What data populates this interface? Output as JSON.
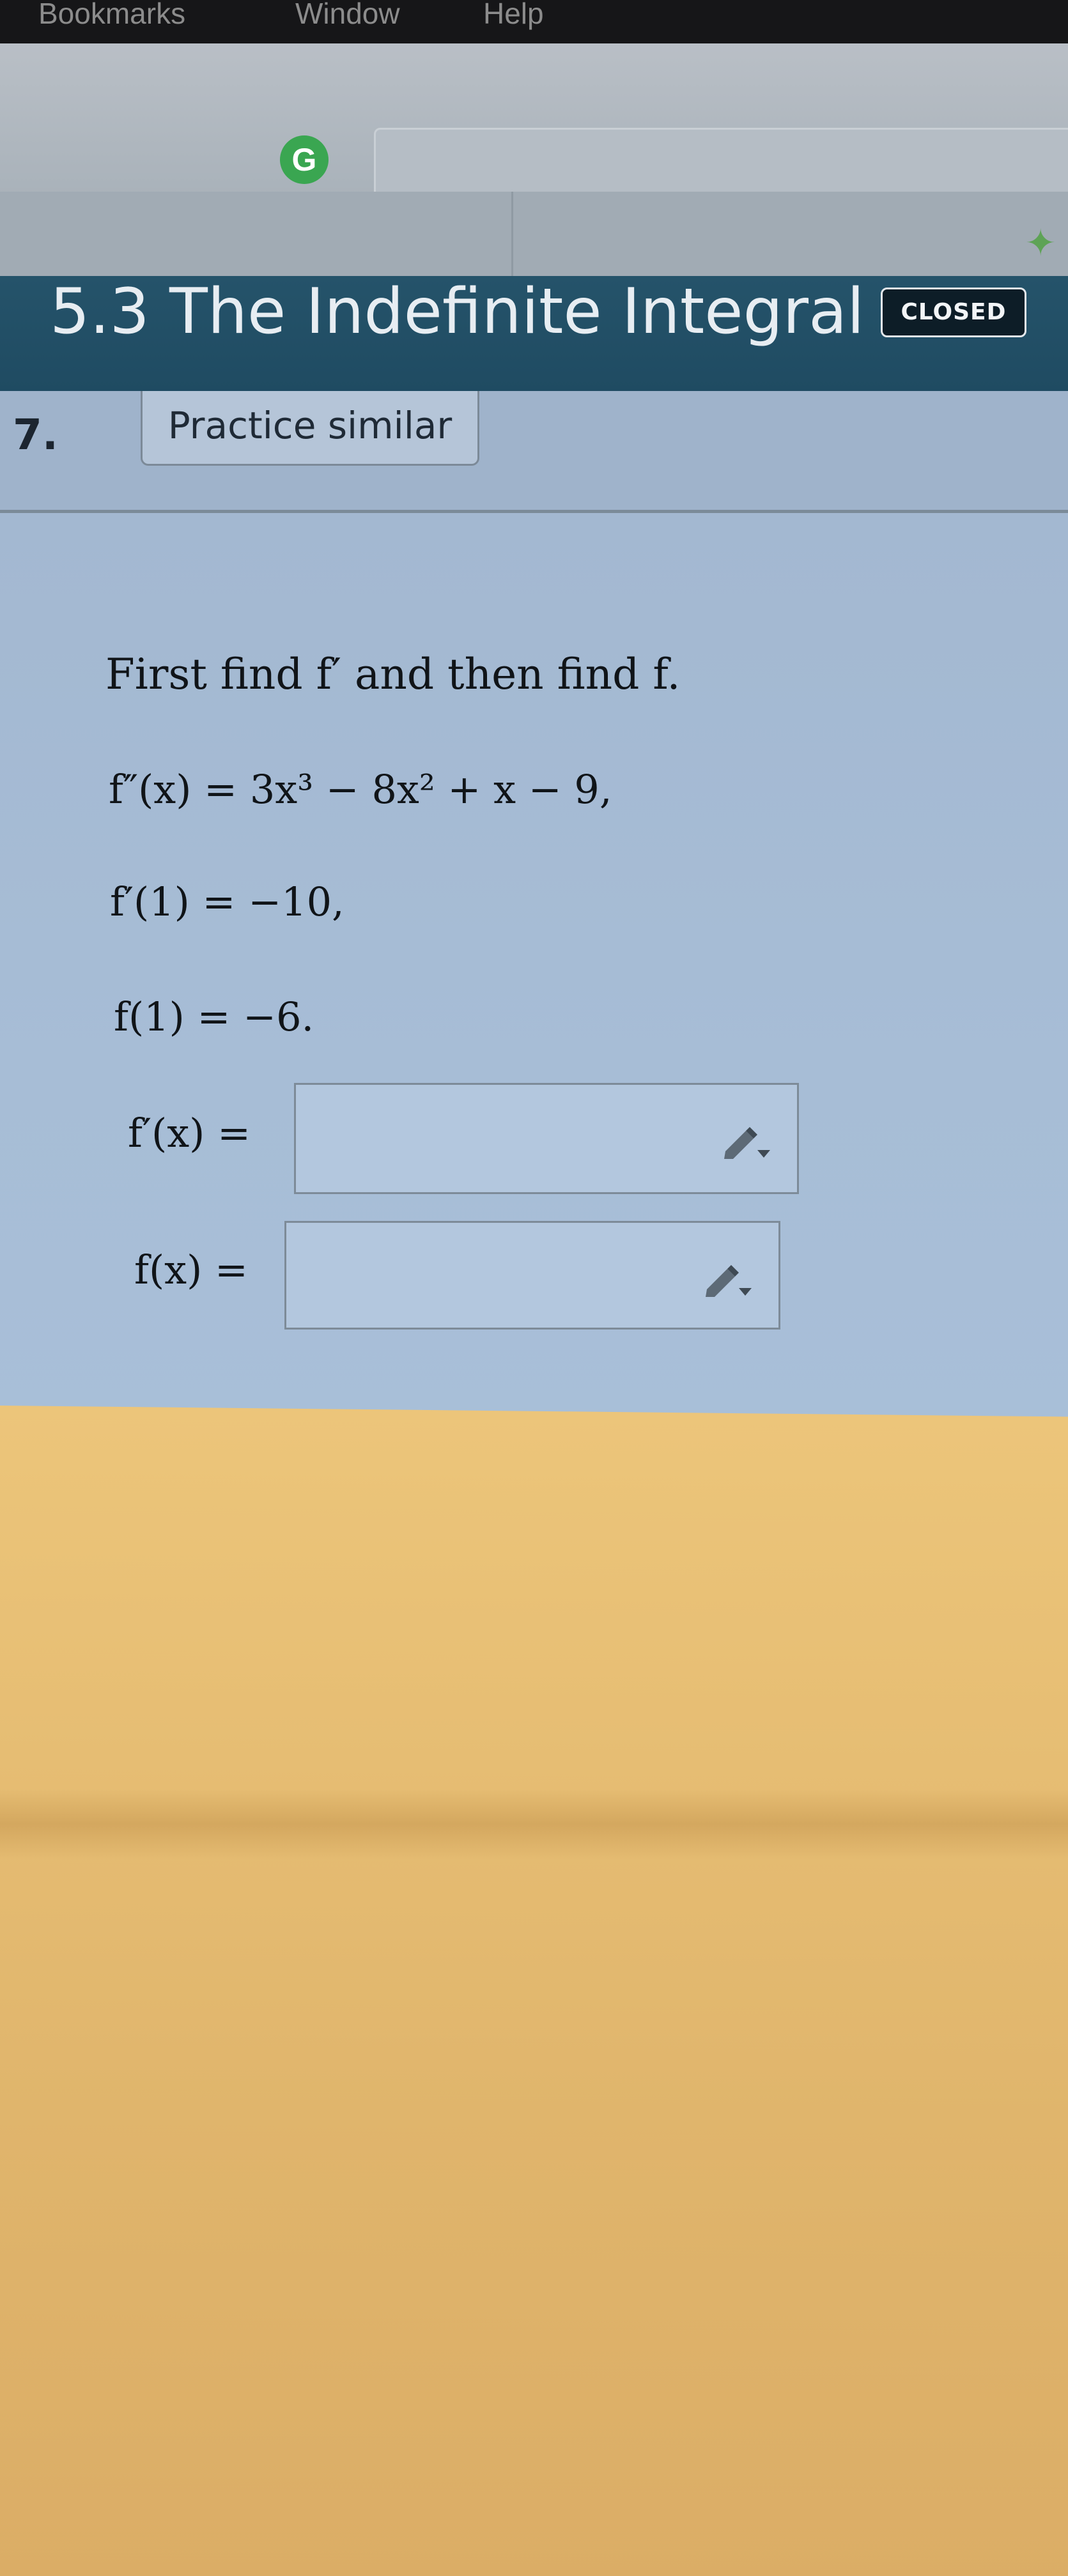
{
  "menubar": {
    "items": [
      "Bookmarks",
      "Window",
      "Help"
    ]
  },
  "toolbar": {
    "extension_letter": "G"
  },
  "section": {
    "title": "5.3 The Indefinite Integral",
    "badge": "CLOSED"
  },
  "question": {
    "number": "7.",
    "practice_label": "Practice similar"
  },
  "problem": {
    "instruction": "First find f′ and then find f.",
    "given": [
      "f″(x) = 3x³ − 8x² + x − 9,",
      "f′(1) = −10,",
      "f(1) = −6."
    ],
    "answers": [
      {
        "label": "f′(x) =",
        "value": ""
      },
      {
        "label": "f(x) =",
        "value": ""
      }
    ]
  },
  "icons": {
    "extension": "extension-g-icon",
    "puzzle": "puzzle-piece-icon",
    "answer_tool": "pencil-dropdown-icon"
  },
  "colors": {
    "section_header": "#25536a",
    "content_bg": "#a3b8d1",
    "badge_bg": "#0d1d27",
    "extension_green": "#3aa651"
  }
}
